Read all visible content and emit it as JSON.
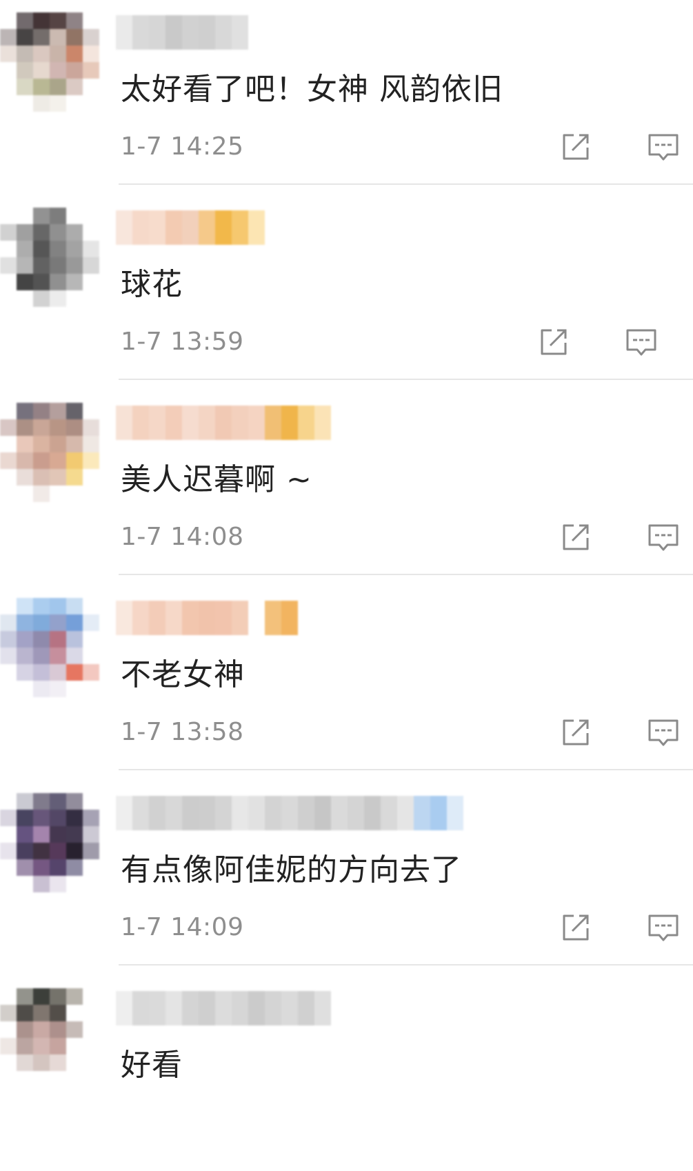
{
  "comments": [
    {
      "text": "太好看了吧！女神 风韵依旧",
      "time": "1-7 14:25"
    },
    {
      "text": "球花",
      "time": "1-7 13:59"
    },
    {
      "text": "美人迟暮啊 ~",
      "time": "1-7 14:08"
    },
    {
      "text": "不老女神",
      "time": "1-7 13:58"
    },
    {
      "text": "有点像阿佳妮的方向去了",
      "time": "1-7 14:09"
    },
    {
      "text": "好看",
      "time": ""
    }
  ],
  "icons": {
    "share": "share-edit-icon",
    "reply": "comment-reply-icon"
  },
  "colors": {
    "text": "#222222",
    "meta": "#8e8e8e",
    "icon": "#8a8a8a",
    "divider": "#e6e6e6"
  }
}
